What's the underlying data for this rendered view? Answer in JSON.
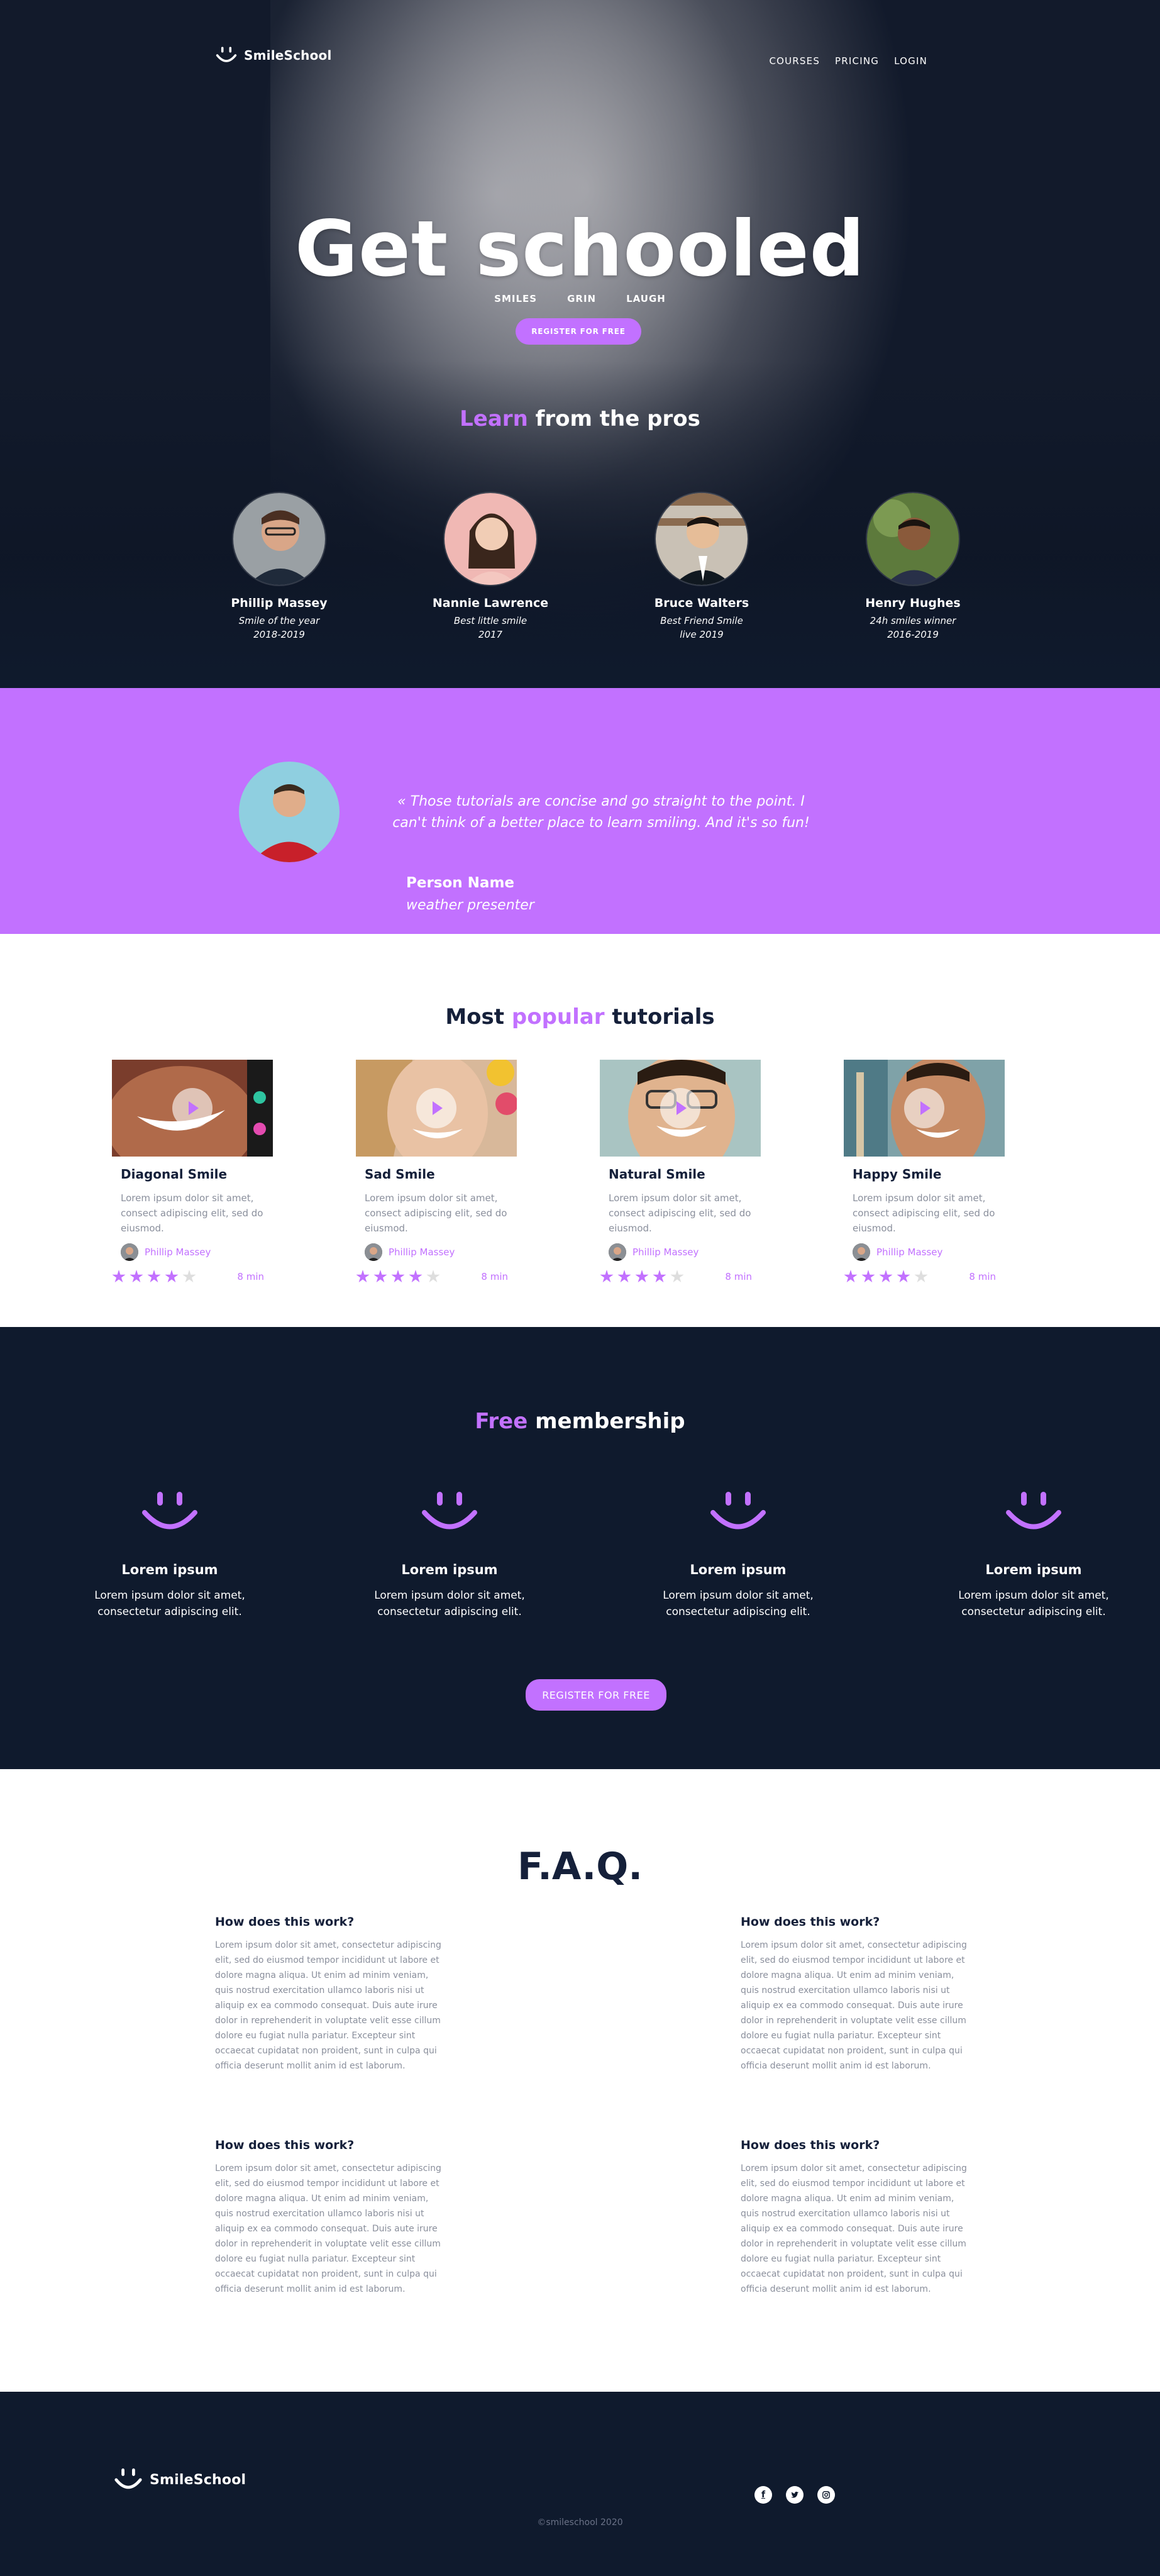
{
  "brand": {
    "name": "SmileSchool"
  },
  "nav": {
    "items": [
      "COURSES",
      "PRICING",
      "LOGIN"
    ]
  },
  "hero": {
    "title": "Get schooled",
    "tags": [
      "SMILES",
      "GRIN",
      "LAUGH"
    ],
    "cta": "REGISTER FOR FREE"
  },
  "learn": {
    "accent": "Learn",
    "rest": " from the pros"
  },
  "pros": [
    {
      "name": "Phillip Massey",
      "title_line1": "Smile of the year",
      "title_line2": "2018-2019"
    },
    {
      "name": "Nannie Lawrence",
      "title_line1": "Best little smile",
      "title_line2": "2017"
    },
    {
      "name": "Bruce Walters",
      "title_line1": "Best Friend Smile",
      "title_line2": "live 2019"
    },
    {
      "name": "Henry Hughes",
      "title_line1": "24h smiles winner",
      "title_line2": "2016-2019"
    }
  ],
  "testimonial": {
    "quote": "« Those tutorials are concise and go straight to the point. I can't think of a better place to learn smiling. And it's so fun!",
    "person_name": "Person Name",
    "person_role": "weather presenter"
  },
  "tutorials": {
    "title_pre": "Most ",
    "title_accent": "popular",
    "title_post": " tutorials",
    "cards": [
      {
        "title": "Diagonal Smile",
        "desc": "Lorem ipsum dolor sit amet, consect adipiscing elit, sed do eiusmod.",
        "author": "Phillip Massey",
        "rating": 4,
        "duration": "8 min"
      },
      {
        "title": "Sad Smile",
        "desc": "Lorem ipsum dolor sit amet, consect adipiscing elit, sed do eiusmod.",
        "author": "Phillip Massey",
        "rating": 4,
        "duration": "8 min"
      },
      {
        "title": "Natural Smile",
        "desc": "Lorem ipsum dolor sit amet, consect adipiscing elit, sed do eiusmod.",
        "author": "Phillip Massey",
        "rating": 4,
        "duration": "8 min"
      },
      {
        "title": "Happy Smile",
        "desc": "Lorem ipsum dolor sit amet, consect adipiscing elit, sed do eiusmod.",
        "author": "Phillip Massey",
        "rating": 4,
        "duration": "8 min"
      }
    ]
  },
  "membership": {
    "title_accent": "Free",
    "title_rest": " membership",
    "features": [
      {
        "title": "Lorem ipsum",
        "line1": "Lorem ipsum dolor sit amet,",
        "line2": "consectetur adipiscing elit."
      },
      {
        "title": "Lorem ipsum",
        "line1": "Lorem ipsum dolor sit amet,",
        "line2": "consectetur adipiscing elit."
      },
      {
        "title": "Lorem ipsum",
        "line1": "Lorem ipsum dolor sit amet,",
        "line2": "consectetur adipiscing elit."
      },
      {
        "title": "Lorem ipsum",
        "line1": "Lorem ipsum dolor sit amet,",
        "line2": "consectetur adipiscing elit."
      }
    ],
    "cta": "REGISTER FOR FREE"
  },
  "faq": {
    "title": "F.A.Q.",
    "items": [
      {
        "q": "How does this work?",
        "a": "Lorem ipsum dolor sit amet, consectetur adipiscing elit, sed do eiusmod tempor incididunt ut labore et dolore magna aliqua. Ut enim ad minim veniam, quis nostrud exercitation ullamco laboris nisi ut aliquip ex ea commodo consequat. Duis aute irure dolor in reprehenderit in voluptate velit esse cillum dolore eu fugiat nulla pariatur. Excepteur sint occaecat cupidatat non proident, sunt in culpa qui officia deserunt mollit anim id est laborum."
      },
      {
        "q": "How does this work?",
        "a": "Lorem ipsum dolor sit amet, consectetur adipiscing elit, sed do eiusmod tempor incididunt ut labore et dolore magna aliqua. Ut enim ad minim veniam, quis nostrud exercitation ullamco laboris nisi ut aliquip ex ea commodo consequat. Duis aute irure dolor in reprehenderit in voluptate velit esse cillum dolore eu fugiat nulla pariatur. Excepteur sint occaecat cupidatat non proident, sunt in culpa qui officia deserunt mollit anim id est laborum."
      },
      {
        "q": "How does this work?",
        "a": "Lorem ipsum dolor sit amet, consectetur adipiscing elit, sed do eiusmod tempor incididunt ut labore et dolore magna aliqua. Ut enim ad minim veniam, quis nostrud exercitation ullamco laboris nisi ut aliquip ex ea commodo consequat. Duis aute irure dolor in reprehenderit in voluptate velit esse cillum dolore eu fugiat nulla pariatur. Excepteur sint occaecat cupidatat non proident, sunt in culpa qui officia deserunt mollit anim id est laborum."
      },
      {
        "q": "How does this work?",
        "a": "Lorem ipsum dolor sit amet, consectetur adipiscing elit, sed do eiusmod tempor incididunt ut labore et dolore magna aliqua. Ut enim ad minim veniam, quis nostrud exercitation ullamco laboris nisi ut aliquip ex ea commodo consequat. Duis aute irure dolor in reprehenderit in voluptate velit esse cillum dolore eu fugiat nulla pariatur. Excepteur sint occaecat cupidatat non proident, sunt in culpa qui officia deserunt mollit anim id est laborum."
      }
    ]
  },
  "footer": {
    "brand": "SmileSchool",
    "socials": [
      "facebook-icon",
      "twitter-icon",
      "instagram-icon"
    ],
    "copyright": "©smileschool 2020"
  },
  "colors": {
    "accent": "#c271ff",
    "navy": "#0f1a2d",
    "text_muted": "#8a8f9c"
  }
}
